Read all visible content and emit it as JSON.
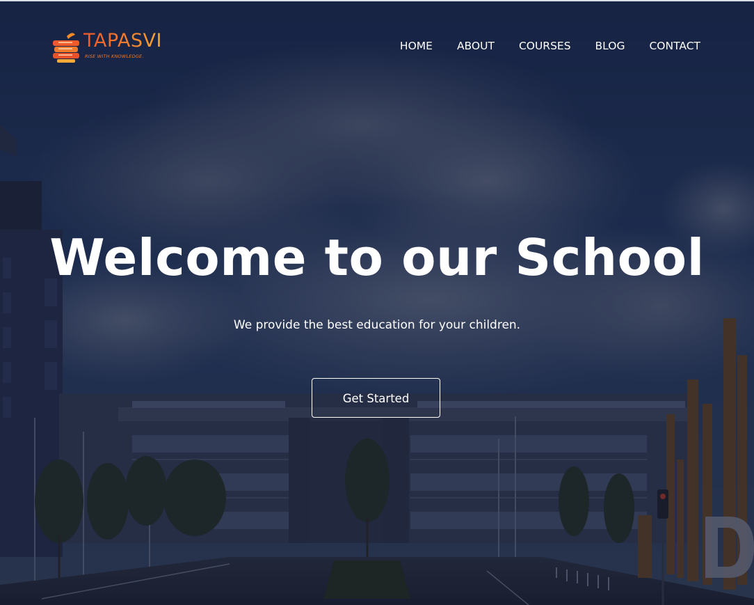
{
  "brand": {
    "name": "TAPASVI",
    "tagline": "RISE WITH KNOWLEDGE."
  },
  "nav": {
    "items": [
      {
        "label": "HOME"
      },
      {
        "label": "ABOUT"
      },
      {
        "label": "COURSES"
      },
      {
        "label": "BLOG"
      },
      {
        "label": "CONTACT"
      }
    ]
  },
  "hero": {
    "title": "Welcome to our School",
    "subtitle": "We provide the best education for your children.",
    "cta_label": "Get Started",
    "background_icon": "school-campus-photo",
    "overlay_color": "#1b2440",
    "sky_color": "#1f3563"
  },
  "colors": {
    "brand_orange": "#ef5a2a",
    "brand_amber": "#f6a938",
    "text_white": "#ffffff"
  }
}
